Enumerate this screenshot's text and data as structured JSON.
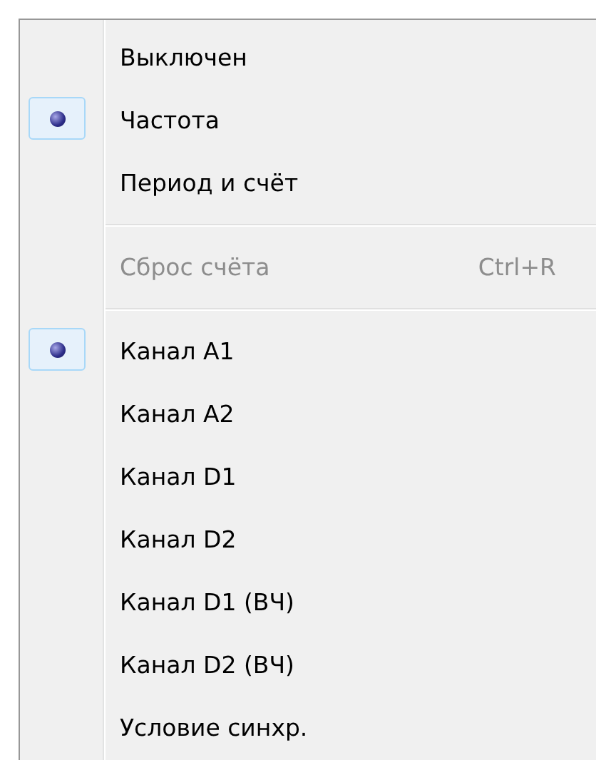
{
  "menu": {
    "items": [
      {
        "kind": "item",
        "label": "Выключен",
        "checked": false,
        "disabled": false
      },
      {
        "kind": "item",
        "label": "Частота",
        "checked": true,
        "disabled": false
      },
      {
        "kind": "item",
        "label": "Период и счёт",
        "checked": false,
        "disabled": false
      },
      {
        "kind": "separator"
      },
      {
        "kind": "item",
        "label": "Сброс счёта",
        "shortcut": "Ctrl+R",
        "checked": false,
        "disabled": true
      },
      {
        "kind": "separator"
      },
      {
        "kind": "item",
        "label": "Канал A1",
        "checked": true,
        "disabled": false
      },
      {
        "kind": "item",
        "label": "Канал A2",
        "checked": false,
        "disabled": false
      },
      {
        "kind": "item",
        "label": "Канал D1",
        "checked": false,
        "disabled": false
      },
      {
        "kind": "item",
        "label": "Канал D2",
        "checked": false,
        "disabled": false
      },
      {
        "kind": "item",
        "label": "Канал D1 (ВЧ)",
        "checked": false,
        "disabled": false
      },
      {
        "kind": "item",
        "label": "Канал D2 (ВЧ)",
        "checked": false,
        "disabled": false
      },
      {
        "kind": "item",
        "label": "Условие синхр.",
        "checked": false,
        "disabled": false
      }
    ]
  }
}
